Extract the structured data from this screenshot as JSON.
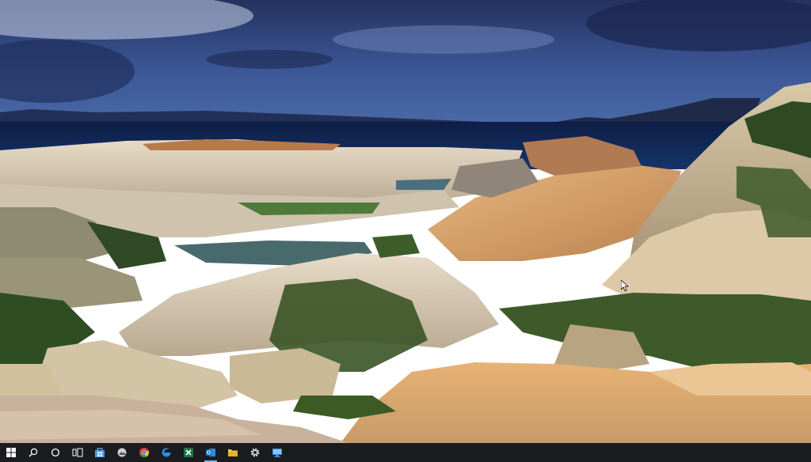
{
  "desktop": {
    "wallpaper": "coastal-rocks-landscape"
  },
  "taskbar": {
    "background": "#1b1c20",
    "start_icon": "windows-start-icon",
    "search_icon": "search-icon",
    "cortana_icon": "cortana-icon",
    "taskview_icon": "task-view-icon",
    "apps": [
      {
        "icon": "store-icon",
        "color": "#4c9be8"
      },
      {
        "icon": "photos-icon",
        "color": "#d0d0d0"
      },
      {
        "icon": "chrome-icon",
        "color": "#e34133"
      },
      {
        "icon": "edge-icon",
        "color": "#2f8de4"
      },
      {
        "icon": "excel-icon",
        "color": "#1e7145"
      },
      {
        "icon": "outlook-icon",
        "color": "#0f6cbd"
      },
      {
        "icon": "file-explorer-icon",
        "color": "#f3c443"
      },
      {
        "icon": "settings-icon",
        "color": "#e8e8e8"
      },
      {
        "icon": "remote-desktop-icon",
        "color": "#3b8ee8"
      }
    ]
  }
}
